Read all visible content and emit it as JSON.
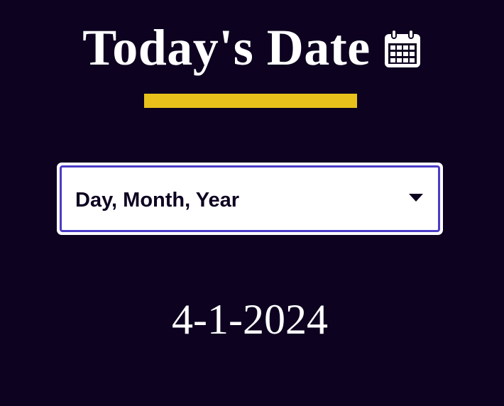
{
  "header": {
    "title": "Today's Date",
    "icon": "calendar-icon"
  },
  "format_select": {
    "selected_label": "Day, Month, Year",
    "icon": "chevron-down-icon"
  },
  "output": {
    "date_text": "4-1-2024"
  },
  "colors": {
    "background": "#0d0220",
    "accent_underline": "#e8c21b",
    "select_border": "#4a3cc4",
    "text_primary": "#ffffff"
  }
}
